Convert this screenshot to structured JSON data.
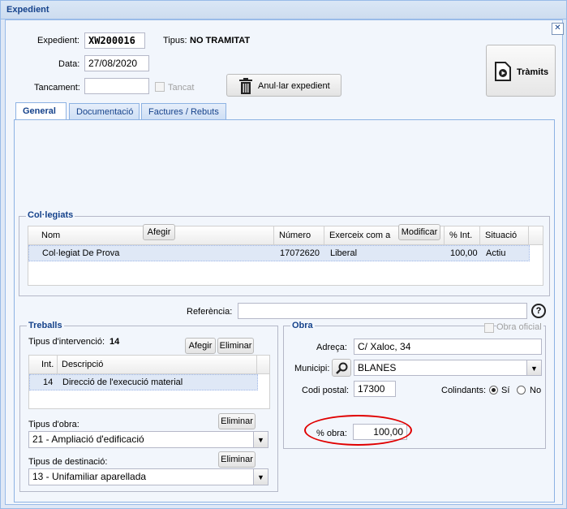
{
  "window": {
    "title": "Expedient"
  },
  "header": {
    "expedient_label": "Expedient:",
    "expedient_value": "XW200016",
    "tipus_label": "Tipus:",
    "tipus_value": "NO TRAMITAT",
    "data_label": "Data:",
    "data_value": "27/08/2020",
    "tancament_label": "Tancament:",
    "tancament_value": "",
    "tancat_label": "Tancat",
    "anular_label": "Anul·lar expedient",
    "tramits_label": "Tràmits"
  },
  "tabs": [
    {
      "label": "General",
      "active": true
    },
    {
      "label": "Documentació",
      "active": false
    },
    {
      "label": "Factures / Rebuts",
      "active": false
    }
  ],
  "collegiats": {
    "legend": "Col·legiats",
    "afegir_label": "Afegir",
    "modificar_label": "Modificar",
    "columns": [
      "Nom",
      "Número",
      "Exerceix com a",
      "% Int.",
      "Situació"
    ],
    "rows": [
      {
        "nom": "Col·legiat De Prova",
        "numero": "17072620",
        "exerceix": "Liberal",
        "int": "100,00",
        "situacio": "Actiu"
      }
    ]
  },
  "referencia": {
    "label": "Referència:",
    "value": "",
    "help_icon": "question-circle-icon"
  },
  "treballs": {
    "legend": "Treballs",
    "tipus_intervencio_label": "Tipus d'intervenció:",
    "tipus_intervencio_value": "14",
    "afegir_label": "Afegir",
    "eliminar_label": "Eliminar",
    "columns": [
      "Int.",
      "Descripció"
    ],
    "rows": [
      {
        "int": "14",
        "descripcio": "Direcció de l'execució material"
      }
    ],
    "tipus_obra_label": "Tipus d'obra:",
    "tipus_obra_value": "21 - Ampliació d'edificació",
    "tipus_obra_eliminar": "Eliminar",
    "tipus_destinacio_label": "Tipus de destinació:",
    "tipus_destinacio_value": "13 - Unifamiliar aparellada",
    "tipus_destinacio_eliminar": "Eliminar"
  },
  "obra": {
    "legend": "Obra",
    "obra_oficial_label": "Obra oficial",
    "adreca_label": "Adreça:",
    "adreca_value": "C/ Xaloc, 34",
    "municipi_label": "Municipi:",
    "municipi_value": "BLANES",
    "codi_postal_label": "Codi postal:",
    "codi_postal_value": "17300",
    "colindants_label": "Colindants:",
    "si_label": "Sí",
    "no_label": "No",
    "colindants_selected": "Sí",
    "percent_obra_label": "% obra:",
    "percent_obra_value": "100,00",
    "highlight_color": "#e00000"
  }
}
